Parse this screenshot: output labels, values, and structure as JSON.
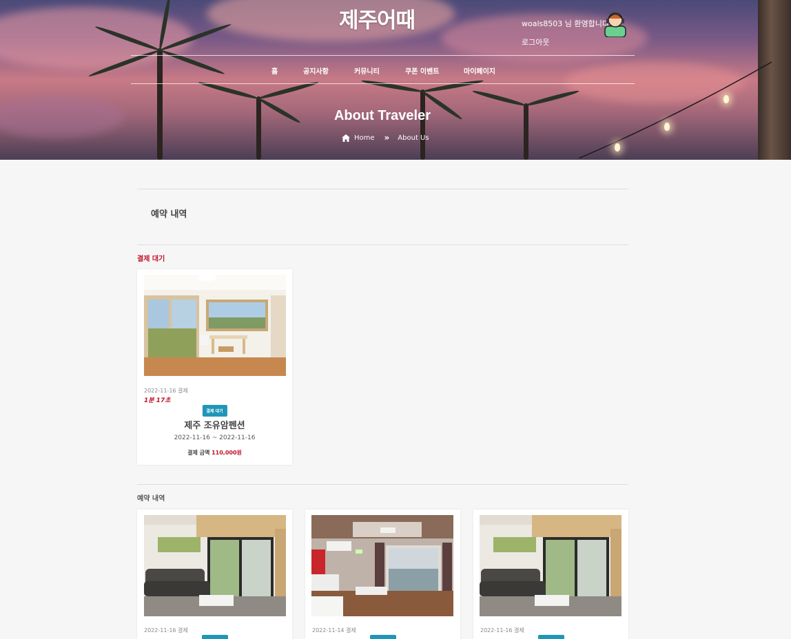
{
  "brand": {
    "logo": "제주어때"
  },
  "user": {
    "welcome": "woals8503 님 환영합니다",
    "logout": "로그아웃"
  },
  "nav": {
    "items": [
      "홈",
      "공지사항",
      "커뮤니티",
      "쿠폰 이벤트",
      "마이페이지"
    ]
  },
  "hero": {
    "title": "About Traveler",
    "breadcrumb": [
      "Home",
      "About Us"
    ]
  },
  "page": {
    "section_title": "예약 내역",
    "pending_label": "결제 대기",
    "history_label": "예약 내역"
  },
  "pending": [
    {
      "pay_date": "2022-11-16 결제",
      "timer": "1분 17초",
      "status": "결제 대기",
      "name": "제주 조유암펜션",
      "dates": "2022-11-16 ~ 2022-11-16",
      "amount_label": "결제 금액",
      "amount": "110,000원"
    }
  ],
  "history": [
    {
      "pay_date": "2022-11-16 결제"
    },
    {
      "pay_date": "2022-11-14 결제"
    },
    {
      "pay_date": "2022-11-16 결제"
    }
  ],
  "colors": {
    "accent_red": "#c2132a",
    "badge_blue": "#1f96b7",
    "page_bg": "#f6f6f6"
  },
  "icons": [
    "home-icon",
    "chevron-double-right-icon",
    "avatar-icon"
  ]
}
